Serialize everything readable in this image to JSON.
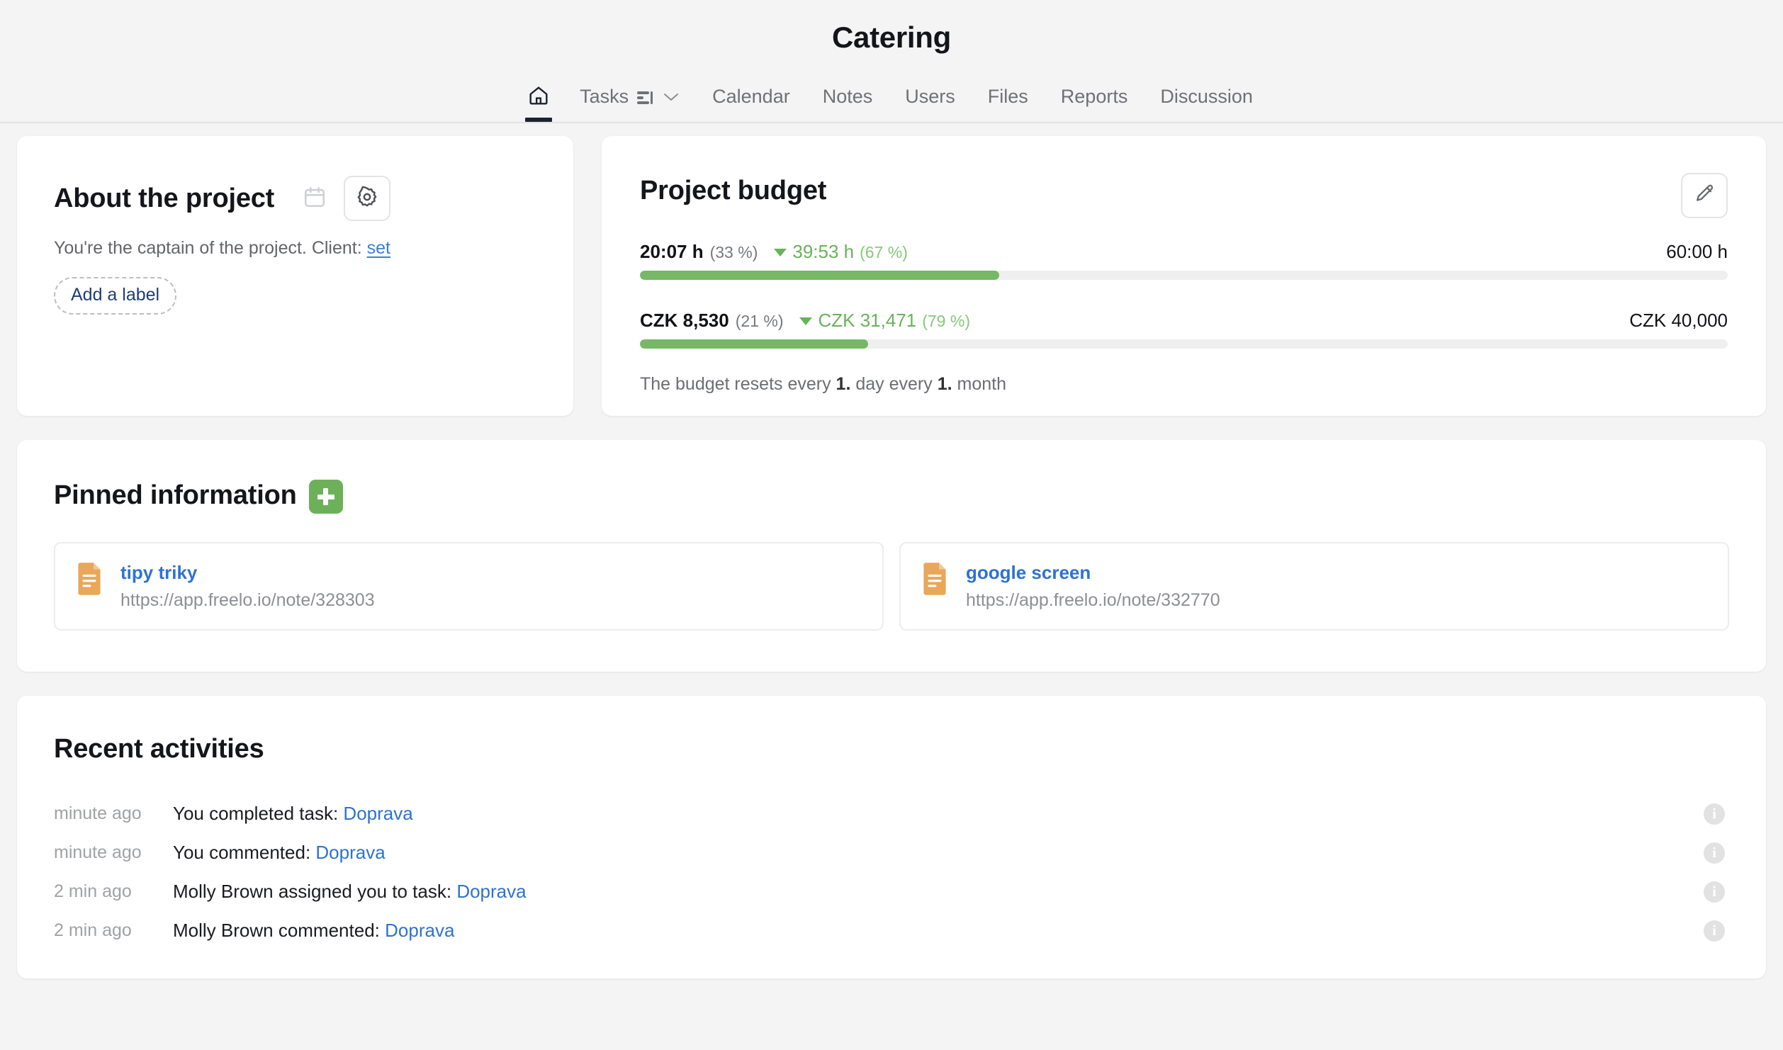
{
  "header": {
    "title": "Catering",
    "nav": [
      {
        "label": "",
        "icon": "home-icon",
        "active": true
      },
      {
        "label": "Tasks",
        "icon": "sort-icon",
        "active": false
      },
      {
        "label": "Calendar",
        "icon": "",
        "active": false
      },
      {
        "label": "Notes",
        "icon": "",
        "active": false
      },
      {
        "label": "Users",
        "icon": "",
        "active": false
      },
      {
        "label": "Files",
        "icon": "",
        "active": false
      },
      {
        "label": "Reports",
        "icon": "",
        "active": false
      },
      {
        "label": "Discussion",
        "icon": "",
        "active": false
      }
    ]
  },
  "about": {
    "title": "About the project",
    "description_prefix": "You're the captain of the project. Client:",
    "client_link": "set",
    "add_label": "Add a label",
    "calendar_icon": "calendar-icon",
    "settings_icon": "gear-icon"
  },
  "budget": {
    "title": "Project budget",
    "edit_icon": "pencil-icon",
    "reset_note_a": "The budget resets every",
    "reset_note_day": "1.",
    "reset_note_b": "day every",
    "reset_note_month": "1.",
    "reset_note_c": "month",
    "rows": [
      {
        "used": "20:07 h",
        "used_pct": "(33 %)",
        "remaining": "39:53 h",
        "remaining_pct": "(67 %)",
        "total": "60:00 h",
        "fill_pct": 33
      },
      {
        "used": "CZK 8,530",
        "used_pct": "(21 %)",
        "remaining": "CZK 31,471",
        "remaining_pct": "(79 %)",
        "total": "CZK 40,000",
        "fill_pct": 21
      }
    ]
  },
  "pinned": {
    "title": "Pinned information",
    "add_icon": "plus-icon",
    "items": [
      {
        "title": "tipy triky",
        "url": "https://app.freelo.io/note/328303",
        "icon": "note-icon"
      },
      {
        "title": "google screen",
        "url": "https://app.freelo.io/note/332770",
        "icon": "note-icon"
      }
    ]
  },
  "activities": {
    "title": "Recent activities",
    "items": [
      {
        "time": "minute ago",
        "text": "You completed task:",
        "link": "Doprava",
        "info_icon": "info-icon"
      },
      {
        "time": "minute ago",
        "text": "You commented:",
        "link": "Doprava",
        "info_icon": "info-icon"
      },
      {
        "time": "2 min ago",
        "text": "Molly Brown assigned you to task:",
        "link": "Doprava",
        "info_icon": "info-icon"
      },
      {
        "time": "2 min ago",
        "text": "Molly Brown commented:",
        "link": "Doprava",
        "info_icon": "info-icon"
      }
    ]
  },
  "colors": {
    "accent_green": "#76b866",
    "link_blue": "#2f72cf",
    "page_bg": "#f4f4f4"
  }
}
